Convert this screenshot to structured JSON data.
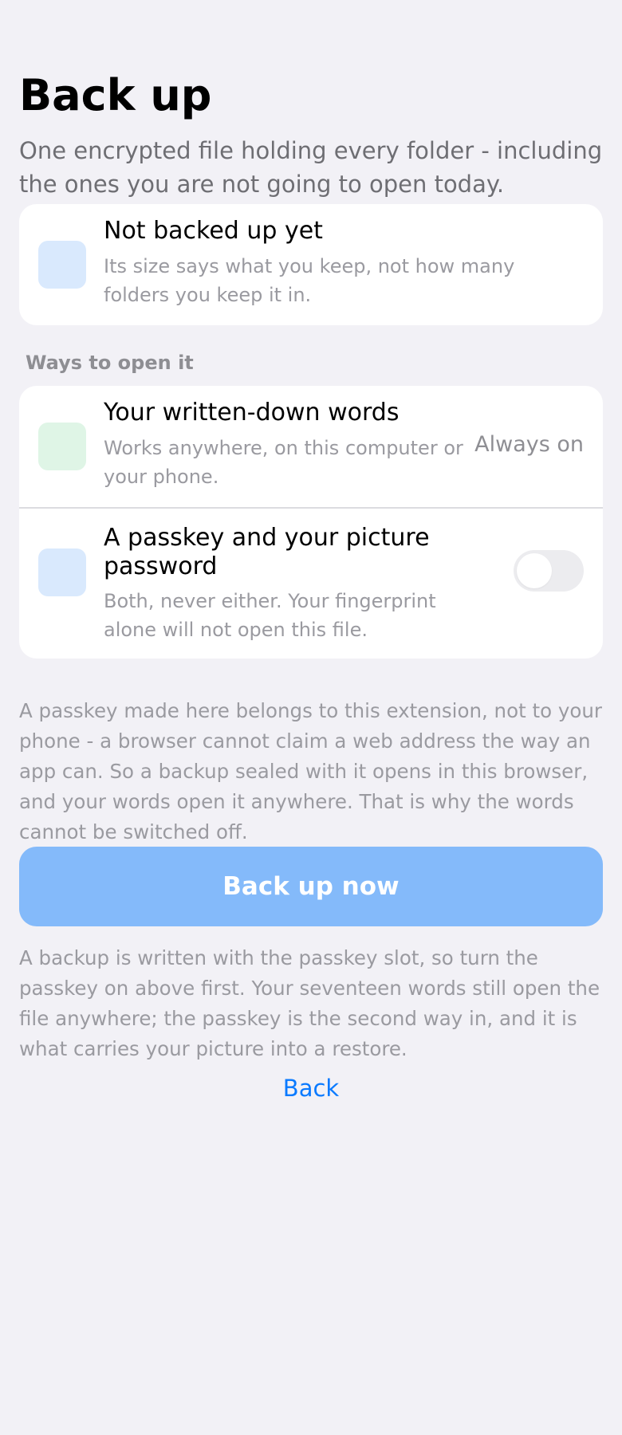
{
  "header": {
    "title": "Back up",
    "subtitle": "One encrypted file holding every folder - including the ones you are not going to open today."
  },
  "status": {
    "title": "Not backed up yet",
    "description": "Its size says what you keep, not how many folders you keep it in."
  },
  "ways": {
    "section_label": "Ways to open it",
    "words": {
      "title": "Your written-down words",
      "description": "Works anywhere, on this computer or your phone.",
      "value": "Always on"
    },
    "passkey": {
      "title": "A passkey and your picture password",
      "description": "Both, never either. Your fingerprint alone will not open this file.",
      "enabled": false
    }
  },
  "explanation": "A passkey made here belongs to this extension, not to your phone - a browser cannot claim a web address the way an app can. So a backup sealed with it opens in this browser, and your words open it anywhere. That is why the words cannot be switched off.",
  "actions": {
    "backup_now_label": "Back up now",
    "backup_now_enabled": false,
    "back_label": "Back"
  },
  "footnote": "A backup is written with the passkey slot, so turn the passkey on above first. Your seventeen words still open the file anywhere; the passkey is the second way in, and it is what carries your picture into a restore.",
  "colors": {
    "background": "#f2f1f6",
    "accent": "#0a7aff",
    "button_disabled": "#84bafa",
    "icon_blue": "#d9e9fd",
    "icon_green": "#dff5e6"
  },
  "icons": {
    "status": "backup-status-icon",
    "words": "written-words-icon",
    "passkey": "passkey-icon"
  }
}
